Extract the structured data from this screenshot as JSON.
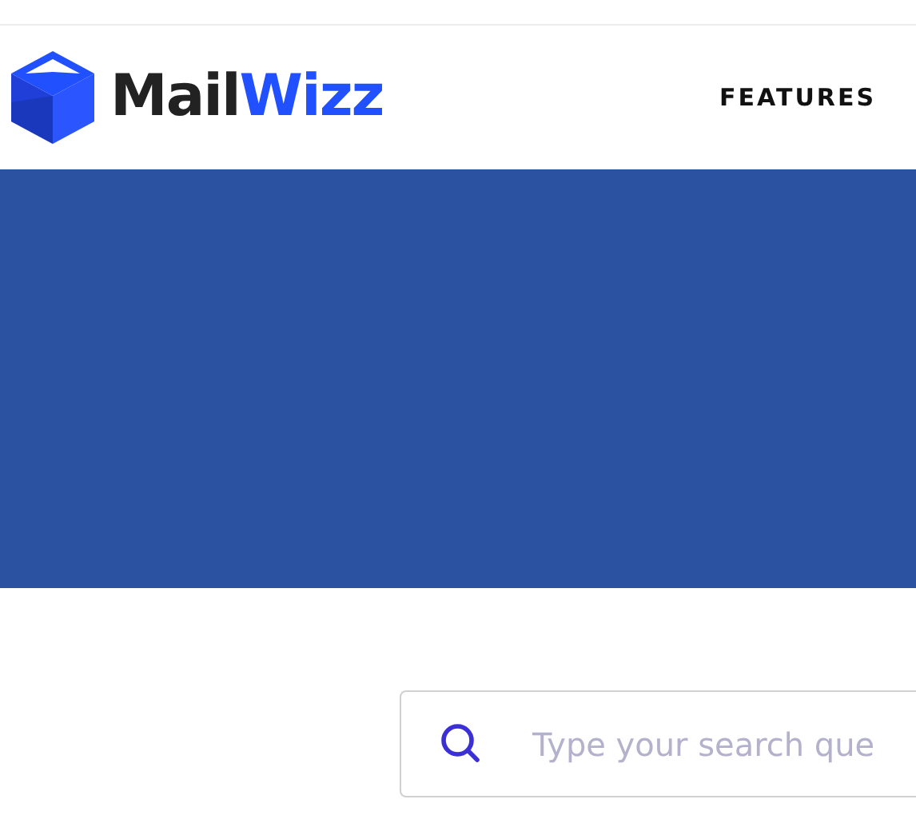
{
  "header": {
    "logo": {
      "text_dark": "Mail",
      "text_accent": "Wizz"
    },
    "nav": [
      "FEATURES"
    ]
  },
  "search": {
    "placeholder": "Type your search que"
  }
}
